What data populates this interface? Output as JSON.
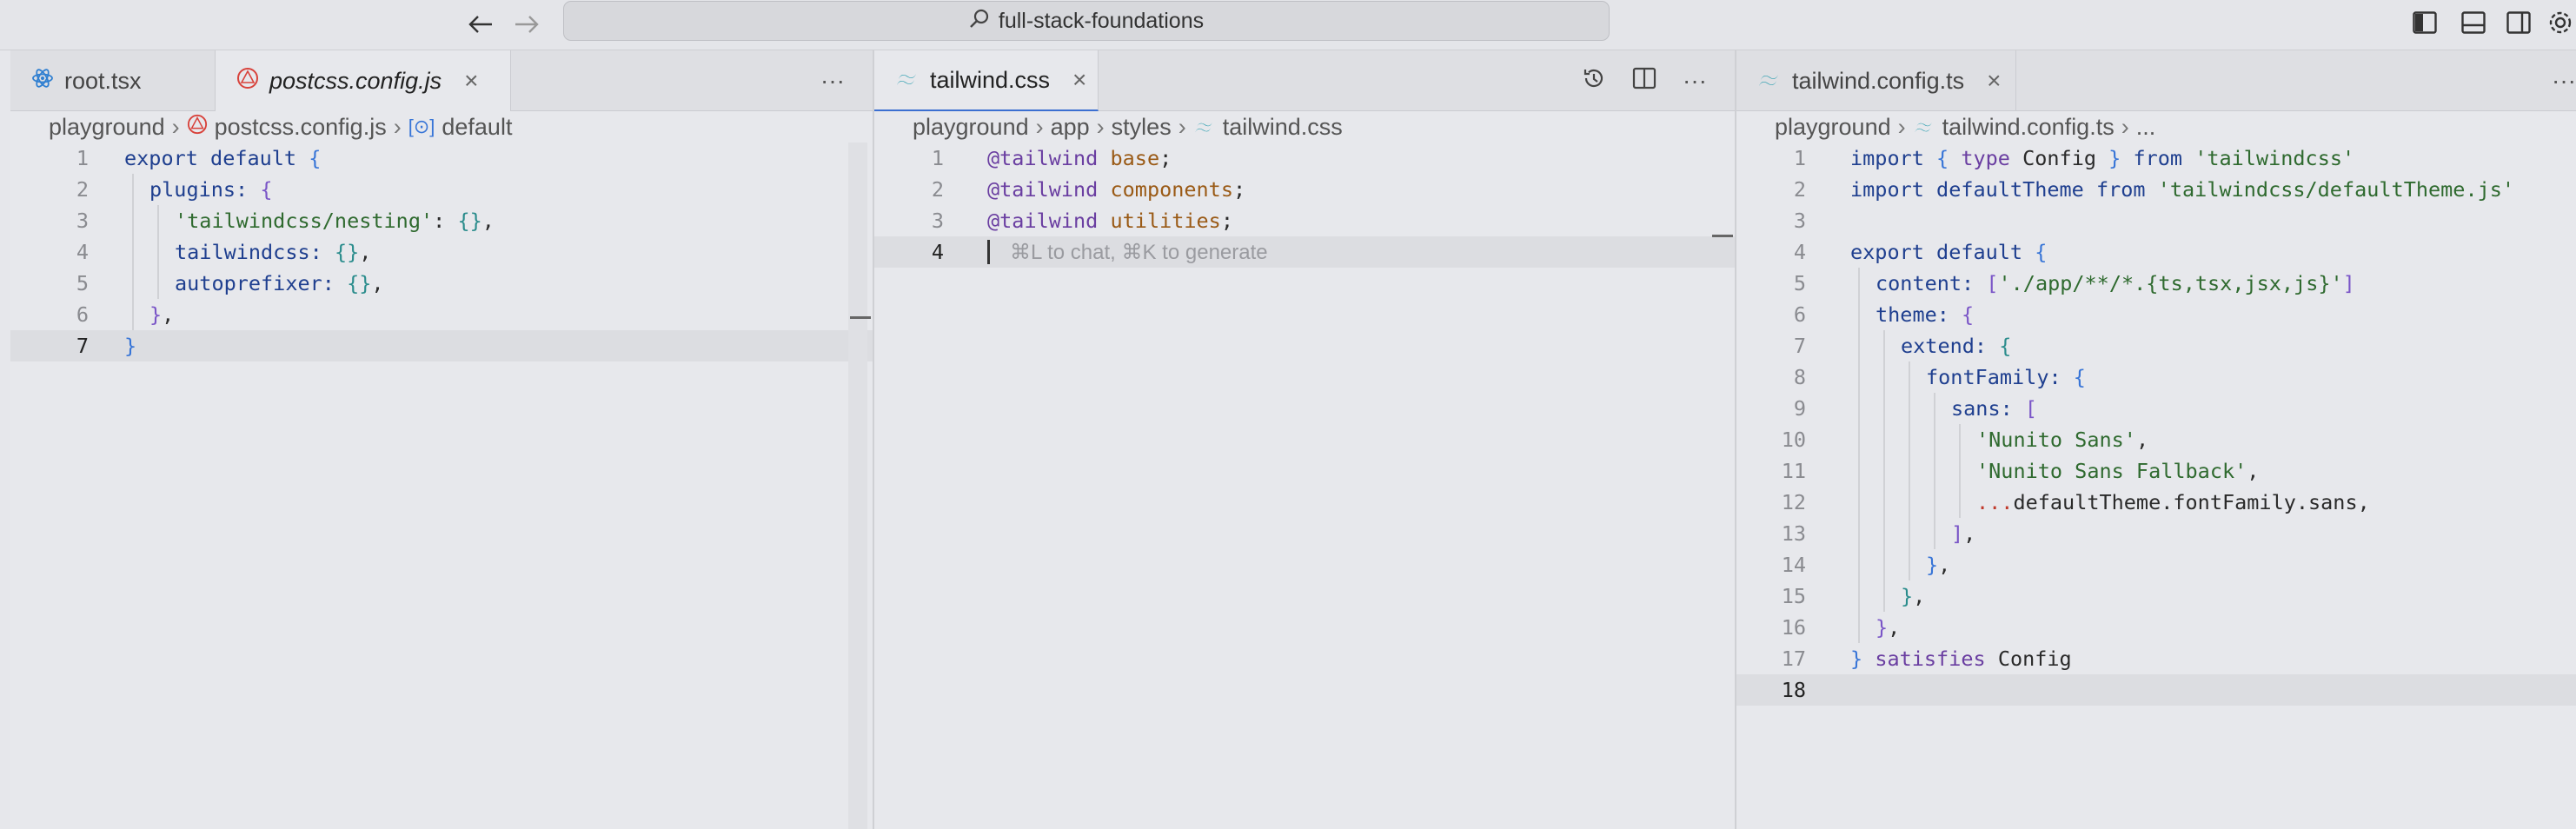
{
  "titlebar": {
    "search_text": "full-stack-foundations",
    "icons": [
      "arrow-left-icon",
      "arrow-right-icon",
      "search-icon",
      "toggle-primary-sidebar-icon",
      "toggle-panel-icon",
      "toggle-secondary-sidebar-icon",
      "settings-gear-icon"
    ]
  },
  "pane1": {
    "tabs": [
      {
        "label": "root.tsx",
        "icon": "react-icon"
      },
      {
        "label": "postcss.config.js",
        "icon": "postcss-icon",
        "close": "×"
      }
    ],
    "more": "···",
    "breadcrumbs": [
      "playground",
      "postcss.config.js",
      "default"
    ],
    "lines": [
      {
        "n": "1"
      },
      {
        "n": "2"
      },
      {
        "n": "3"
      },
      {
        "n": "4"
      },
      {
        "n": "5"
      },
      {
        "n": "6"
      },
      {
        "n": "7"
      }
    ],
    "code": {
      "l1a": "export",
      "l1b": "default",
      "l1c": "{",
      "l2a": "plugins:",
      "l2b": "{",
      "l3a": "'tailwindcss/nesting'",
      "l3b": ":",
      "l3c": "{}",
      "l3d": ",",
      "l4a": "tailwindcss:",
      "l4b": "{}",
      "l4c": ",",
      "l5a": "autoprefixer:",
      "l5b": "{}",
      "l5c": ",",
      "l6a": "}",
      "l6b": ",",
      "l7a": "}"
    }
  },
  "pane2": {
    "tab": {
      "label": "tailwind.css",
      "icon": "tailwind-icon",
      "close": "×"
    },
    "actions": [
      "history-icon",
      "split-editor-icon",
      "more-icon"
    ],
    "more": "···",
    "breadcrumbs": [
      "playground",
      "app",
      "styles",
      "tailwind.css"
    ],
    "lines": [
      {
        "n": "1"
      },
      {
        "n": "2"
      },
      {
        "n": "3"
      },
      {
        "n": "4"
      }
    ],
    "code": {
      "l1a": "@tailwind",
      "l1b": "base",
      "l1c": ";",
      "l2a": "@tailwind",
      "l2b": "components",
      "l2c": ";",
      "l3a": "@tailwind",
      "l3b": "utilities",
      "l3c": ";",
      "hint": "⌘L to chat, ⌘K to generate"
    }
  },
  "pane3": {
    "tab": {
      "label": "tailwind.config.ts",
      "icon": "tailwind-icon",
      "close": "×"
    },
    "more": "···",
    "breadcrumbs": [
      "playground",
      "tailwind.config.ts",
      "..."
    ],
    "lines": [
      {
        "n": "1"
      },
      {
        "n": "2"
      },
      {
        "n": "3"
      },
      {
        "n": "4"
      },
      {
        "n": "5"
      },
      {
        "n": "6"
      },
      {
        "n": "7"
      },
      {
        "n": "8"
      },
      {
        "n": "9"
      },
      {
        "n": "10"
      },
      {
        "n": "11"
      },
      {
        "n": "12"
      },
      {
        "n": "13"
      },
      {
        "n": "14"
      },
      {
        "n": "15"
      },
      {
        "n": "16"
      },
      {
        "n": "17"
      },
      {
        "n": "18"
      }
    ],
    "code": {
      "l1a": "import",
      "l1b": "{",
      "l1c": "type",
      "l1d": "Config",
      "l1e": "}",
      "l1f": "from",
      "l1g": "'tailwindcss'",
      "l2a": "import",
      "l2b": "defaultTheme",
      "l2c": "from",
      "l2d": "'tailwindcss/defaultTheme.js'",
      "l4a": "export",
      "l4b": "default",
      "l4c": "{",
      "l5a": "content:",
      "l5b": "[",
      "l5c": "'./app/**/*.{ts,tsx,jsx,js}'",
      "l5d": "]",
      ",l5e": ",",
      "l6a": "theme:",
      "l6b": "{",
      "l7a": "extend:",
      "l7b": "{",
      "l8a": "fontFamily:",
      "l8b": "{",
      "l9a": "sans:",
      "l9b": "[",
      "l10a": "'Nunito Sans'",
      "l10b": ",",
      "l11a": "'Nunito Sans Fallback'",
      "l11b": ",",
      "l12a": "...",
      "l12b": "defaultTheme.fontFamily.sans,",
      "l13a": "]",
      "l13b": ",",
      "l14a": "}",
      "l14b": ",",
      "l15a": "}",
      "l15b": ",",
      "l16a": "}",
      "l16b": ",",
      "l17a": "}",
      "l17b": "satisfies",
      "l17c": "Config"
    }
  }
}
